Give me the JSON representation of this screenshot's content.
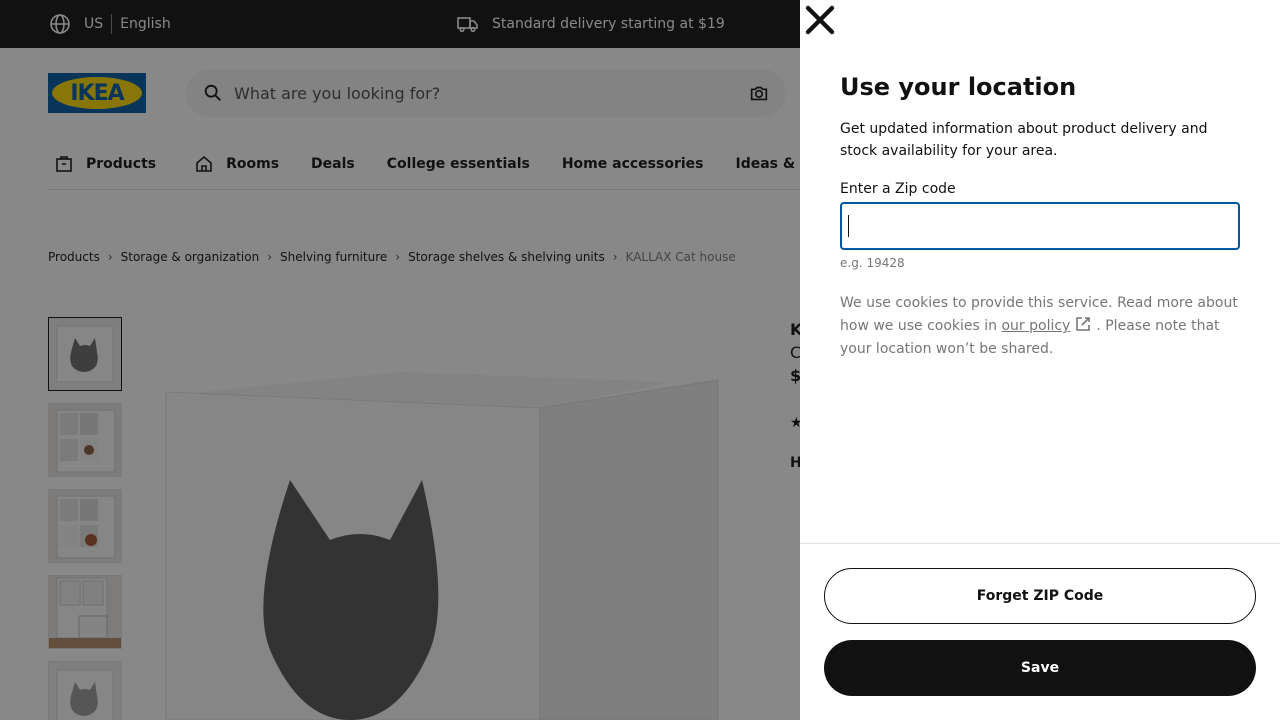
{
  "topbar": {
    "country": "US",
    "language": "English",
    "delivery_text": "Standard delivery starting at $19"
  },
  "logo": {
    "text": "IKEA"
  },
  "search": {
    "placeholder": "What are you looking for?"
  },
  "nav": {
    "items": [
      {
        "label": "Products",
        "icon": "products-icon"
      },
      {
        "label": "Rooms",
        "icon": "rooms-icon"
      },
      {
        "label": "Deals"
      },
      {
        "label": "College essentials"
      },
      {
        "label": "Home accessories"
      },
      {
        "label": "Ideas & inspira"
      }
    ]
  },
  "breadcrumb": {
    "items": [
      "Products",
      "Storage & organization",
      "Shelving furniture",
      "Storage shelves & shelving units"
    ],
    "current": "KALLAX Cat house"
  },
  "product_peek": {
    "name_initial": "K",
    "sub_initial": "C",
    "price_initial": "$",
    "section_initial": "H"
  },
  "modal": {
    "title": "Use your location",
    "description": "Get updated information about product delivery and stock availability for your area.",
    "zip_label": "Enter a Zip code",
    "zip_value": "",
    "zip_hint": "e.g. 19428",
    "cookie_text_before": "We use cookies to provide this service. Read more about how we use cookies in ",
    "cookie_link": "our policy",
    "cookie_text_after": ". Please note that your location won’t be shared.",
    "forget_button": "Forget ZIP Code",
    "save_button": "Save"
  }
}
